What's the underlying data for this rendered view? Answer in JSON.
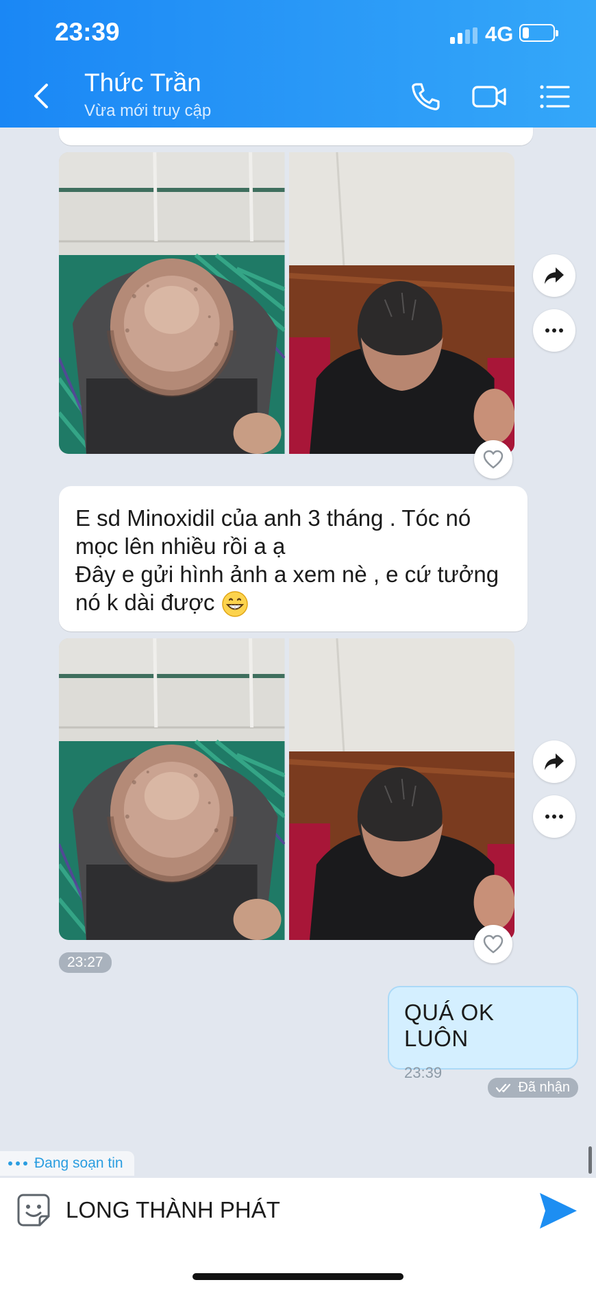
{
  "status_bar": {
    "time": "23:39",
    "network": "4G",
    "battery_icon": "battery-low-icon"
  },
  "header": {
    "contact_name": "Thức Trần",
    "status": "Vừa mới truy cập",
    "icons": [
      "back-icon",
      "phone-icon",
      "video-call-icon",
      "menu-icon"
    ]
  },
  "messages": [
    {
      "type": "photo_group",
      "photos": [
        "balding-scalp-top-view",
        "grown-hair-selfie"
      ],
      "actions": [
        "forward-icon",
        "more-icon",
        "heart-icon"
      ]
    },
    {
      "type": "text",
      "lines": [
        "E sd Minoxidil của anh 3 tháng . Tóc nó",
        "mọc lên nhiều rồi a ạ",
        "Đây e gửi hình ảnh a xem nè , e cứ tưởng",
        "nó k dài được"
      ],
      "emoji": "grinning-face-icon"
    },
    {
      "type": "photo_group",
      "photos": [
        "balding-scalp-top-view",
        "grown-hair-selfie"
      ],
      "actions": [
        "forward-icon",
        "more-icon",
        "heart-icon"
      ],
      "time": "23:27"
    },
    {
      "type": "sent_text",
      "text": "QUÁ OK LUÔN",
      "time": "23:39",
      "delivery_status": "Đã nhận"
    }
  ],
  "typing_indicator": "Đang soạn tin",
  "composer": {
    "value": "LONG THÀNH PHÁT",
    "icons": [
      "sticker-icon",
      "send-icon"
    ]
  },
  "colors": {
    "header": "#2a99f7",
    "chat_background": "#e2e7ef",
    "sent_bubble": "#d4efff",
    "accent": "#2a9de0"
  }
}
